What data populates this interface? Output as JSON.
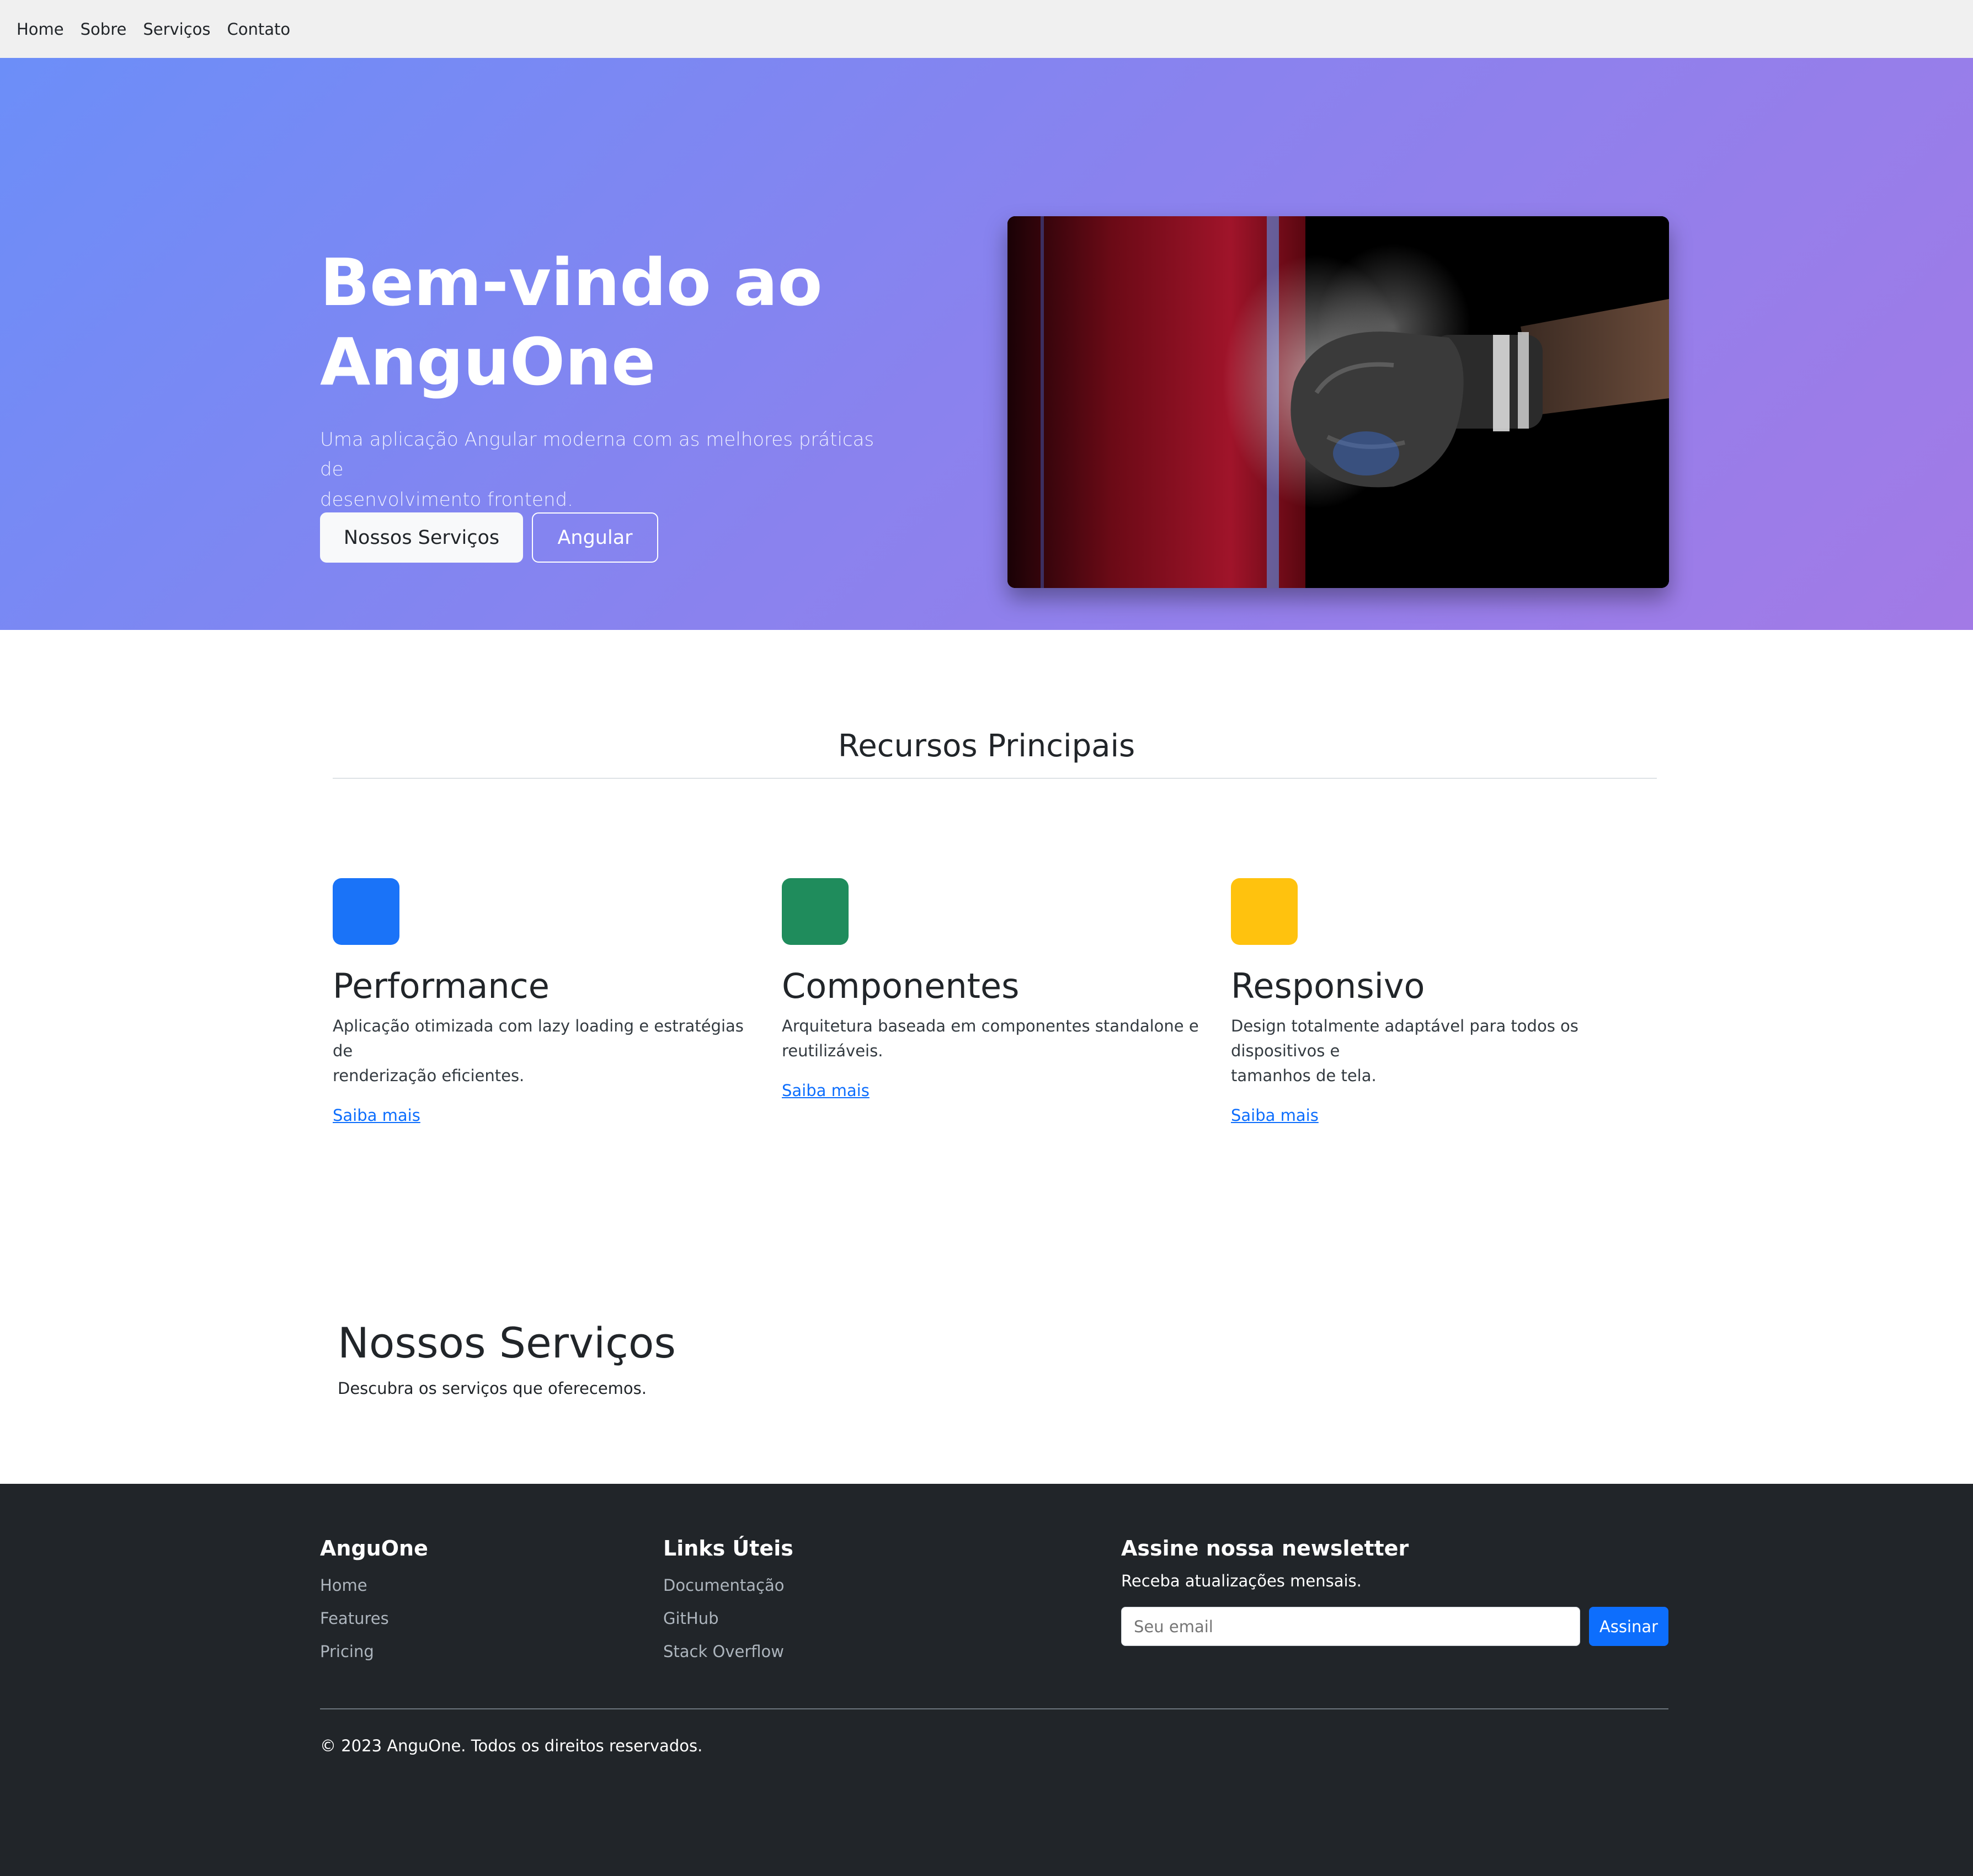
{
  "nav": {
    "items": [
      {
        "label": "Home"
      },
      {
        "label": "Sobre"
      },
      {
        "label": "Serviços"
      },
      {
        "label": "Contato"
      }
    ]
  },
  "hero": {
    "title_line1": "Bem-vindo ao",
    "title_line2": "AnguOne",
    "subtitle_line1": "Uma aplicação Angular moderna com as melhores práticas de",
    "subtitle_line2": "desenvolvimento frontend.",
    "primary_button": "Nossos Serviços",
    "secondary_button": "Angular",
    "image_icon": "boxing-glove-image"
  },
  "features": {
    "title": "Recursos Principais",
    "cards": [
      {
        "title": "Performance",
        "line1": "Aplicação otimizada com lazy loading e estratégias de",
        "line2": "renderização eficientes.",
        "link": "Saiba mais",
        "color": "#0d6efd"
      },
      {
        "title": "Componentes",
        "line1": "Arquitetura baseada em componentes standalone e",
        "line2": "reutilizáveis.",
        "link": "Saiba mais",
        "color": "#198754"
      },
      {
        "title": "Responsivo",
        "line1": "Design totalmente adaptável para todos os dispositivos e",
        "line2": "tamanhos de tela.",
        "link": "Saiba mais",
        "color": "#ffc107"
      }
    ]
  },
  "services": {
    "title": "Nossos Serviços",
    "subtitle": "Descubra os serviços que oferecemos."
  },
  "footer": {
    "brand": "AnguOne",
    "brand_links": [
      {
        "label": "Home"
      },
      {
        "label": "Features"
      },
      {
        "label": "Pricing"
      }
    ],
    "links_title": "Links Úteis",
    "useful_links": [
      {
        "label": "Documentação"
      },
      {
        "label": "GitHub"
      },
      {
        "label": "Stack Overflow"
      }
    ],
    "newsletter_title": "Assine nossa newsletter",
    "newsletter_desc": "Receba atualizações mensais.",
    "email_placeholder": "Seu email",
    "subscribe_button": "Assinar",
    "copyright": "© 2023 AnguOne. Todos os direitos reservados."
  },
  "colors": {
    "hero_gradient_start": "#6c8ef8",
    "hero_gradient_end": "#a27ae6",
    "footer_bg": "#212529",
    "link": "#0d6efd"
  }
}
